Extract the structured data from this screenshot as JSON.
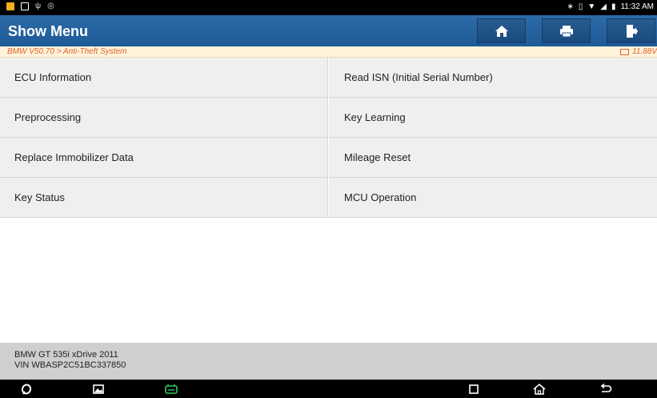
{
  "status_bar": {
    "left_icons": [
      "notification-icon",
      "image-icon",
      "usb-icon",
      "sync-icon"
    ],
    "right_icons": [
      "bluetooth-icon",
      "vibrate-icon",
      "wifi-icon",
      "signal-icon",
      "battery-icon"
    ],
    "time": "11:32 AM"
  },
  "header": {
    "title": "Show Menu",
    "buttons": [
      "home-icon",
      "print-icon",
      "exit-icon"
    ],
    "color": "#2462a0"
  },
  "breadcrumb": {
    "path": "BMW V50.70 > Anti-Theft System",
    "voltage": "11.88V",
    "color": "#e0602a"
  },
  "menu": {
    "items": [
      "ECU Information",
      "Read ISN (Initial Serial Number)",
      "Preprocessing",
      "Key Learning",
      "Replace Immobilizer Data",
      "Mileage Reset",
      "Key Status",
      "MCU Operation"
    ]
  },
  "vehicle": {
    "model": "BMW GT 535i xDrive 2011",
    "vin": "VIN WBASP2C51BC337850"
  },
  "nav_bar": {
    "buttons": [
      "browser-icon",
      "gallery-icon",
      "diagnostic-icon",
      "recents-icon",
      "home-nav-icon",
      "back-icon"
    ]
  }
}
